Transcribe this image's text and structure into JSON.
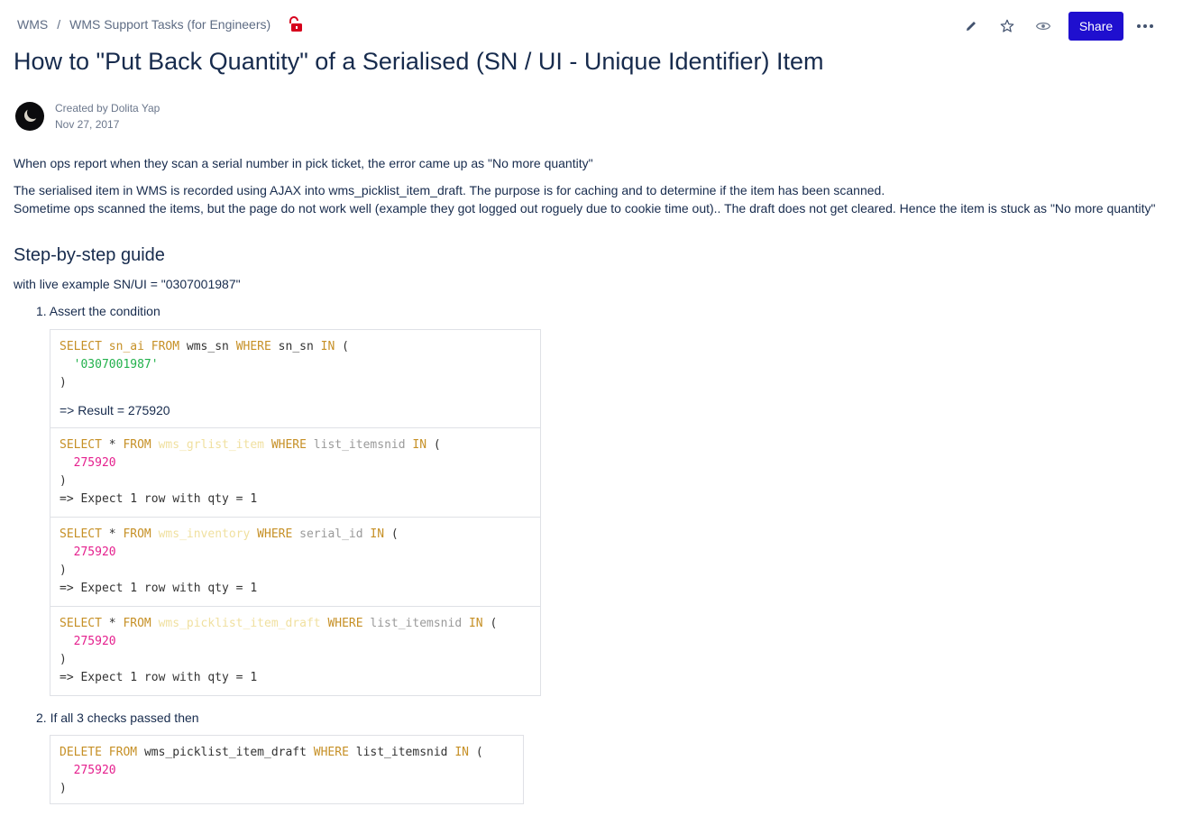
{
  "breadcrumb": {
    "items": [
      "WMS",
      "WMS Support Tasks (for Engineers)"
    ],
    "separator": "/"
  },
  "toolbar": {
    "share_label": "Share",
    "more_label": "•••"
  },
  "page": {
    "title": "How to \"Put Back Quantity\" of a Serialised (SN / UI - Unique Identifier) Item",
    "created_by": "Created by Dolita Yap",
    "created_date": "Nov 27, 2017"
  },
  "body": {
    "p1": "When ops report when they scan a serial number in pick ticket, the error came up as \"No more quantity\"",
    "p2": "The serialised item in WMS is recorded using AJAX into wms_picklist_item_draft. The purpose is for caching and to determine if the item has been scanned.",
    "p3": "Sometime ops scanned the items, but the page do not work well (example they got logged out roguely due to cookie time out).. The draft does not get cleared. Hence the item is stuck as \"No more quantity\"",
    "heading": "Step-by-step guide",
    "example": "with live example SN/UI = \"0307001987\"",
    "step1": "1. Assert the condition",
    "step2": "2. If all 3 checks passed then"
  },
  "code": {
    "select": "SELECT",
    "from": "FROM",
    "where": "WHERE",
    "in": "IN",
    "delete": "DELETE",
    "star": "*",
    "open_paren": "(",
    "close_paren": ")",
    "q1": {
      "col": "sn_ai",
      "table": "wms_sn",
      "field": "sn_sn",
      "value": "'0307001987'",
      "result": "=> Result = 275920"
    },
    "q2": {
      "table": "wms_grlist_item",
      "field": "list_itemsnid",
      "value": "275920",
      "expect": "=> Expect 1 row with qty = 1"
    },
    "q3": {
      "table": "wms_inventory",
      "field": "serial_id",
      "value": "275920",
      "expect": "=> Expect 1 row with qty = 1"
    },
    "q4": {
      "table": "wms_picklist_item_draft",
      "field": "list_itemsnid",
      "value": "275920",
      "expect": "=> Expect 1 row with qty = 1"
    },
    "q5": {
      "table": "wms_picklist_item_draft",
      "field": "list_itemsnid",
      "value": "275920"
    }
  },
  "icons": [
    "unlock-icon",
    "edit-icon",
    "star-icon",
    "watch-icon",
    "more-icon"
  ],
  "colors": {
    "share": "#1f0fcf",
    "lock": "#d6001c",
    "keyword": "#c69026",
    "string": "#22b14c",
    "number": "#e5208e"
  }
}
